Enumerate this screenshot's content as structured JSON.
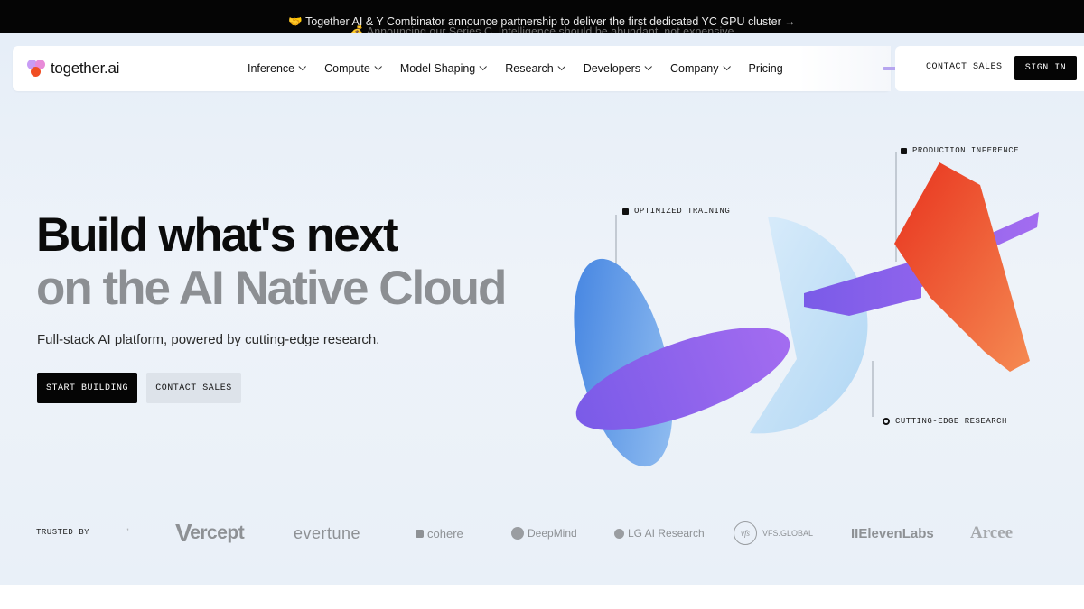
{
  "announcement": {
    "primary": "🤝 Together AI & Y Combinator announce partnership to deliver the first dedicated YC GPU cluster →",
    "secondary": "💰 Announcing our Series C. Intelligence should be abundant, not expensive"
  },
  "brand": {
    "name": "together.ai"
  },
  "nav": {
    "items": [
      {
        "label": "Inference",
        "has_menu": true
      },
      {
        "label": "Compute",
        "has_menu": true
      },
      {
        "label": "Model Shaping",
        "has_menu": true
      },
      {
        "label": "Research",
        "has_menu": true
      },
      {
        "label": "Developers",
        "has_menu": true
      },
      {
        "label": "Company",
        "has_menu": true
      },
      {
        "label": "Pricing",
        "has_menu": false
      }
    ],
    "contact_label": "CONTACT SALES",
    "signin_label": "SIGN IN"
  },
  "hero": {
    "headline_line1": "Build what's next",
    "headline_line2": "on the AI Native Cloud",
    "subheadline": "Full-stack AI platform, powered by cutting-edge research.",
    "primary_cta": "START BUILDING",
    "secondary_cta": "CONTACT SALES"
  },
  "illustration": {
    "callouts": {
      "training": "OPTIMIZED TRAINING",
      "inference": "PRODUCTION INFERENCE",
      "research": "CUTTING-EDGE RESEARCH"
    }
  },
  "trusted": {
    "label": "TRUSTED BY",
    "logos": {
      "fragment": "ʼ",
      "vercept_v": "V",
      "vercept": "ercept",
      "evertune": "evertune",
      "cohere": "cohere",
      "deepmind": "DeepMind",
      "lg": "LG AI Research",
      "vfs_mark": "vfs",
      "vfs": "VFS.GLOBAL",
      "elevenlabs": "IIElevenLabs",
      "arcee": "Arcee"
    }
  },
  "colors": {
    "accent_red": "#f04e23",
    "accent_purple": "#8b5cf6",
    "accent_blue": "#4a8fe0"
  }
}
